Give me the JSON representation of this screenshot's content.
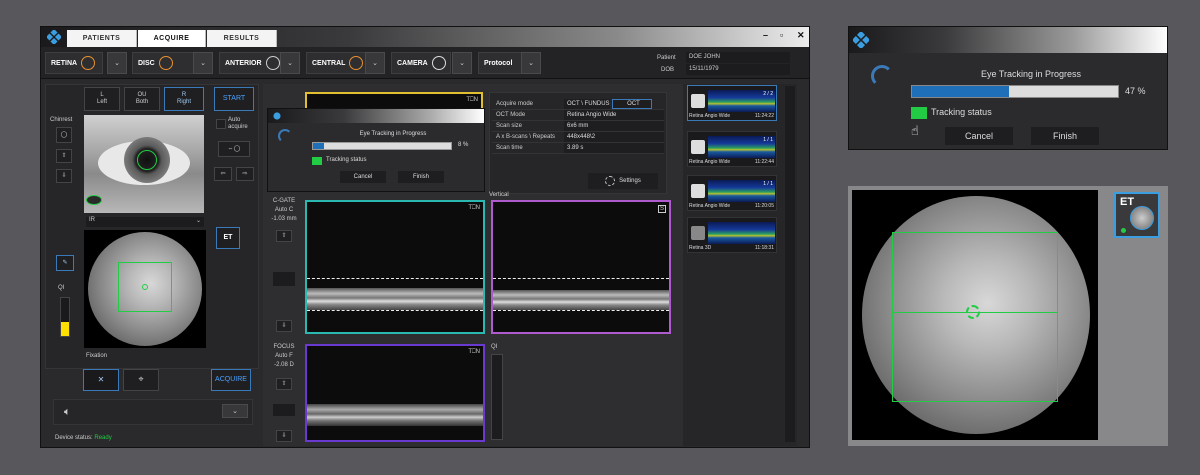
{
  "tabs": [
    "PATIENTS",
    "ACQUIRE",
    "RESULTS"
  ],
  "window_controls": [
    "–",
    "▫",
    "✕"
  ],
  "modes": [
    {
      "label": "RETINA",
      "icon": "retina-icon"
    },
    {
      "label": "DISC",
      "icon": "disc-icon"
    },
    {
      "label": "ANTERIOR",
      "icon": "anterior-icon"
    },
    {
      "label": "CENTRAL",
      "icon": "central-icon"
    },
    {
      "label": "CAMERA",
      "icon": "camera-icon"
    },
    {
      "label": "Protocol",
      "icon": ""
    }
  ],
  "dropdown_glyph": "⌄",
  "patient": {
    "patient_label": "Patient",
    "patient_value": "DOE JOHN",
    "dob_label": "DOB",
    "dob_value": "15/11/1979"
  },
  "eye_select": {
    "left": "L\nLeft",
    "both": "OU\nBoth",
    "right": "R\nRight",
    "start": "START"
  },
  "chinrest_label": "Chinrest",
  "auto_acquire": "Auto\nacquire",
  "ir_label": "IR",
  "et_label": "ET",
  "qi_label": "QI",
  "fixation_label": "Fixation",
  "fixation_buttons": [
    "✕",
    "⌖"
  ],
  "acquire_button": "ACQUIRE",
  "device_status": {
    "label": "Device status:",
    "value": "Ready"
  },
  "volume_icon": "speaker-icon",
  "tracking_popup": {
    "title": "Eye Tracking in Progress",
    "percent": "8 %",
    "progress": 0.08,
    "status": "Tracking status",
    "cancel": "Cancel",
    "finish": "Finish"
  },
  "acq_table": {
    "rows": [
      {
        "k": "Acquire mode",
        "v": "OCT \\ FUNDUS",
        "v2": "OCT"
      },
      {
        "k": "OCT Mode",
        "v": "Retina Angio Wide"
      },
      {
        "k": "Scan size",
        "v": "6x6 mm"
      },
      {
        "k": "A x B-scans \\ Repeats",
        "v": "448x448\\2"
      },
      {
        "k": "Scan time",
        "v": "3.89 s"
      }
    ],
    "settings": "Settings"
  },
  "cgate": {
    "label": "C-GATE",
    "mode": "Auto C",
    "value": "-1.03 mm"
  },
  "focus": {
    "label": "FOCUS",
    "mode": "Auto F",
    "value": "-2.08 D"
  },
  "vertical_label": "Vertical",
  "qi_small": "QI",
  "tn_label": "T⎕N",
  "thumbs": [
    {
      "caption": "Retina Angio Wide",
      "time": "11:24:22",
      "count": "2 / 2",
      "side": "L"
    },
    {
      "caption": "Retina Angio Wide",
      "time": "11:22:44",
      "count": "1 / 1",
      "side": "L"
    },
    {
      "caption": "Retina Angio Wide",
      "time": "11:20:05",
      "count": "1 / 1",
      "side": "R"
    },
    {
      "caption": "Retina 3D",
      "time": "11:18:31",
      "count": "",
      "side": ""
    }
  ],
  "zoom_dialog": {
    "title": "Eye Tracking in Progress",
    "percent": "47 %",
    "progress": 0.47,
    "status": "Tracking status",
    "cancel": "Cancel",
    "finish": "Finish"
  },
  "colors": {
    "accent": "#1e6fb8",
    "green": "#22cc44",
    "yellow": "#ffe000",
    "cyan": "#2ab8b0",
    "violet": "#b05ad0",
    "purple": "#6a3ad0",
    "gold": "#e0c030"
  }
}
